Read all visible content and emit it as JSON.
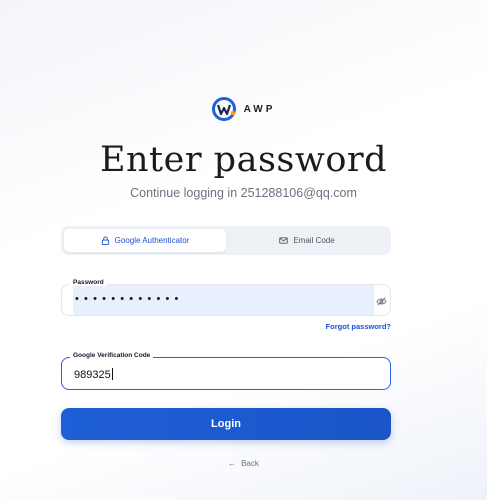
{
  "brand": {
    "logo_icon": "awp-w-logo-icon",
    "logo_text": "AWP",
    "colors": {
      "primary": "#1d4ed8",
      "button": "#1e5ed6",
      "autofill": "#e8f0fe"
    }
  },
  "header": {
    "title": "Enter password",
    "subtitle": "Continue logging in 251288106@qq.com"
  },
  "tabs": [
    {
      "label": "Google Authenticator",
      "icon": "lock-icon",
      "active": true
    },
    {
      "label": "Email Code",
      "icon": "mail-icon",
      "active": false
    }
  ],
  "password": {
    "label": "Password",
    "value_masked": "••••••••••••",
    "toggle_icon": "eye-off-icon"
  },
  "forgot_label": "Forgot password?",
  "verification": {
    "label": "Google Verification Code",
    "value": "989325"
  },
  "login_label": "Login",
  "back": {
    "icon": "arrow-left-icon",
    "label": "Back"
  }
}
